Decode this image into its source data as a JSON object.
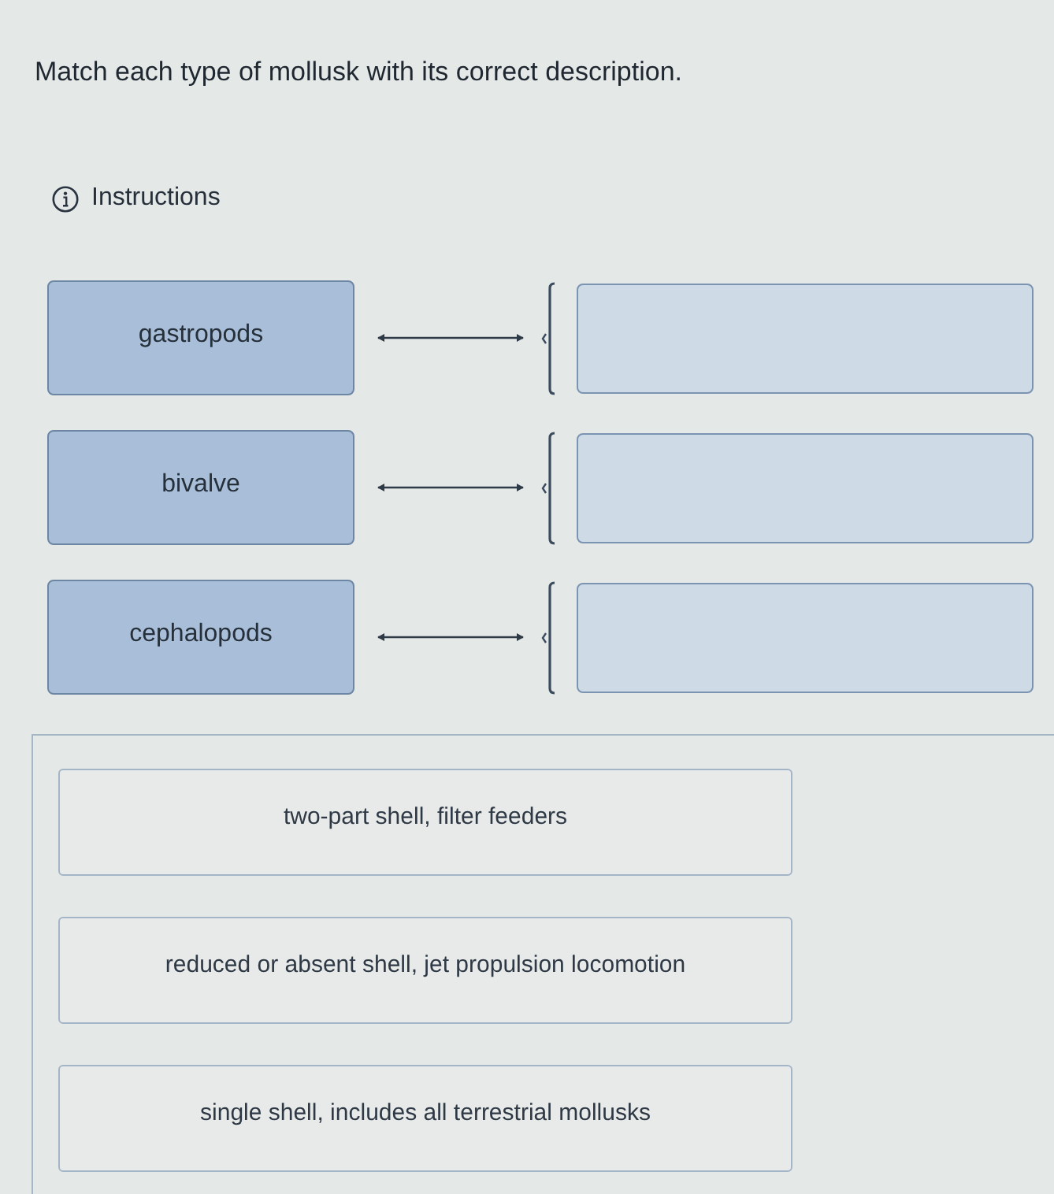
{
  "prompt": "Match each type of mollusk with its correct description.",
  "instructions_link": {
    "label": "Instructions"
  },
  "pairs": [
    {
      "term": "gastropods"
    },
    {
      "term": "bivalve"
    },
    {
      "term": "cephalopods"
    }
  ],
  "choices": [
    "two-part shell, filter feeders",
    "reduced or absent shell, jet propulsion locomotion",
    "single shell, includes all terrestrial mollusks"
  ]
}
